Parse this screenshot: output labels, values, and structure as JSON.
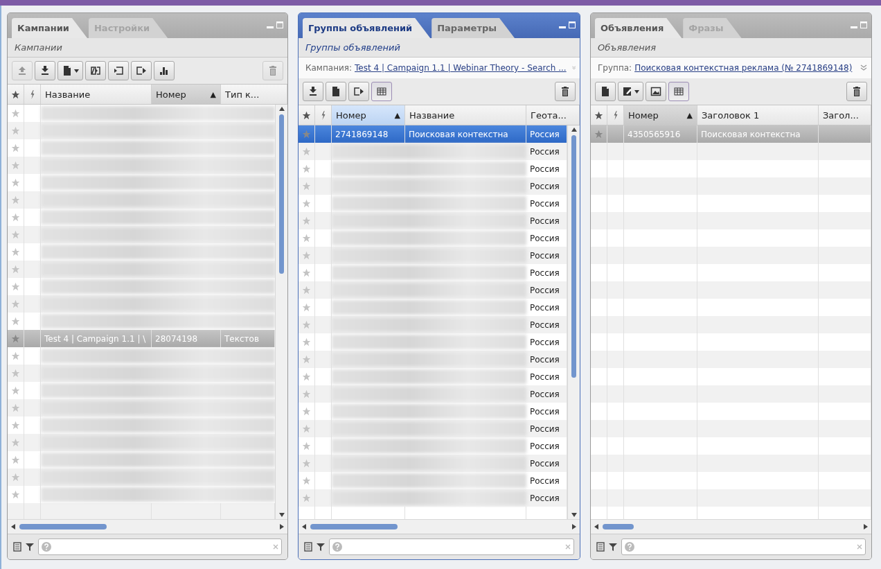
{
  "panels": [
    {
      "active": false,
      "tabs": [
        {
          "label": "Кампании",
          "selected": true
        },
        {
          "label": "Настройки",
          "selected": false
        }
      ],
      "subtitle": "Кампании",
      "toolbar": {
        "left": [
          {
            "kind": "upload",
            "disabled": true,
            "pressed": false
          },
          {
            "kind": "download",
            "disabled": false,
            "pressed": false
          },
          {
            "kind": "document-menu",
            "disabled": false,
            "pressed": false
          },
          {
            "kind": "split",
            "disabled": false,
            "pressed": false
          },
          {
            "kind": "box-in",
            "disabled": false,
            "pressed": false
          },
          {
            "kind": "box-out",
            "disabled": false,
            "pressed": false
          },
          {
            "kind": "chart",
            "disabled": false,
            "pressed": false
          }
        ],
        "right": [
          {
            "kind": "trash",
            "disabled": true,
            "pressed": false
          }
        ]
      },
      "table": {
        "columns": [
          {
            "label": "Название",
            "sorted": false
          },
          {
            "label": "Номер",
            "sorted": true,
            "sort_mark": "▲"
          },
          {
            "label": "Тип к...",
            "sorted": false
          }
        ],
        "rows": [
          {
            "selected": false,
            "blurred": true,
            "cells": []
          },
          {
            "selected": false,
            "blurred": true,
            "cells": []
          },
          {
            "selected": false,
            "blurred": true,
            "cells": []
          },
          {
            "selected": false,
            "blurred": true,
            "cells": []
          },
          {
            "selected": false,
            "blurred": true,
            "cells": []
          },
          {
            "selected": false,
            "blurred": true,
            "cells": []
          },
          {
            "selected": false,
            "blurred": true,
            "cells": []
          },
          {
            "selected": false,
            "blurred": true,
            "cells": []
          },
          {
            "selected": false,
            "blurred": true,
            "cells": []
          },
          {
            "selected": false,
            "blurred": true,
            "cells": []
          },
          {
            "selected": false,
            "blurred": true,
            "cells": []
          },
          {
            "selected": false,
            "blurred": true,
            "cells": []
          },
          {
            "selected": false,
            "blurred": true,
            "cells": []
          },
          {
            "selected": true,
            "blurred": false,
            "cells": [
              "Test 4 | Campaign 1.1 | \\",
              "28074198",
              "Текстов"
            ]
          },
          {
            "selected": false,
            "blurred": true,
            "cells": []
          },
          {
            "selected": false,
            "blurred": true,
            "cells": []
          },
          {
            "selected": false,
            "blurred": true,
            "cells": []
          },
          {
            "selected": false,
            "blurred": true,
            "cells": []
          },
          {
            "selected": false,
            "blurred": true,
            "cells": []
          },
          {
            "selected": false,
            "blurred": true,
            "cells": []
          },
          {
            "selected": false,
            "blurred": true,
            "cells": []
          },
          {
            "selected": false,
            "blurred": true,
            "cells": []
          },
          {
            "selected": false,
            "blurred": true,
            "cells": []
          }
        ]
      }
    },
    {
      "active": true,
      "tabs": [
        {
          "label": "Группы объявлений",
          "selected": true
        },
        {
          "label": "Параметры",
          "selected": false
        }
      ],
      "subtitle": "Группы объявлений",
      "context": {
        "label": "Кампания:",
        "link": "Test 4 | Campaign 1.1 | Webinar Theory - Search ..."
      },
      "toolbar": {
        "left": [
          {
            "kind": "download",
            "disabled": false,
            "pressed": false
          },
          {
            "kind": "document",
            "disabled": false,
            "pressed": false
          },
          {
            "kind": "box-out",
            "disabled": false,
            "pressed": false
          },
          {
            "kind": "grid",
            "disabled": false,
            "pressed": true
          }
        ],
        "right": [
          {
            "kind": "trash",
            "disabled": false,
            "pressed": false
          }
        ]
      },
      "table": {
        "columns": [
          {
            "label": "Номер",
            "sorted": true,
            "sort_mark": "▲"
          },
          {
            "label": "Название",
            "sorted": false
          },
          {
            "label": "Геота...",
            "sorted": false
          }
        ],
        "rows": [
          {
            "selected": true,
            "blurred": false,
            "cells": [
              "2741869148",
              "Поисковая контекстна",
              "Россия"
            ]
          },
          {
            "selected": false,
            "blurred": true,
            "cells": [
              "Россия"
            ]
          },
          {
            "selected": false,
            "blurred": true,
            "cells": [
              "Россия"
            ]
          },
          {
            "selected": false,
            "blurred": true,
            "cells": [
              "Россия"
            ]
          },
          {
            "selected": false,
            "blurred": true,
            "cells": [
              "Россия"
            ]
          },
          {
            "selected": false,
            "blurred": true,
            "cells": [
              "Россия"
            ]
          },
          {
            "selected": false,
            "blurred": true,
            "cells": [
              "Россия"
            ]
          },
          {
            "selected": false,
            "blurred": true,
            "cells": [
              "Россия"
            ]
          },
          {
            "selected": false,
            "blurred": true,
            "cells": [
              "Россия"
            ]
          },
          {
            "selected": false,
            "blurred": true,
            "cells": [
              "Россия"
            ]
          },
          {
            "selected": false,
            "blurred": true,
            "cells": [
              "Россия"
            ]
          },
          {
            "selected": false,
            "blurred": true,
            "cells": [
              "Россия"
            ]
          },
          {
            "selected": false,
            "blurred": true,
            "cells": [
              "Россия"
            ]
          },
          {
            "selected": false,
            "blurred": true,
            "cells": [
              "Россия"
            ]
          },
          {
            "selected": false,
            "blurred": true,
            "cells": [
              "Россия"
            ]
          },
          {
            "selected": false,
            "blurred": true,
            "cells": [
              "Россия"
            ]
          },
          {
            "selected": false,
            "blurred": true,
            "cells": [
              "Россия"
            ]
          },
          {
            "selected": false,
            "blurred": true,
            "cells": [
              "Россия"
            ]
          },
          {
            "selected": false,
            "blurred": true,
            "cells": [
              "Россия"
            ]
          },
          {
            "selected": false,
            "blurred": true,
            "cells": [
              "Россия"
            ]
          },
          {
            "selected": false,
            "blurred": true,
            "cells": [
              "Россия"
            ]
          },
          {
            "selected": false,
            "blurred": true,
            "cells": [
              "Россия"
            ]
          }
        ]
      }
    },
    {
      "active": false,
      "tabs": [
        {
          "label": "Объявления",
          "selected": true
        },
        {
          "label": "Фразы",
          "selected": false
        }
      ],
      "subtitle": "Объявления",
      "context": {
        "label": "Группа:",
        "link": "Поисковая контекстная реклама (№ 2741869148)"
      },
      "toolbar": {
        "left": [
          {
            "kind": "document",
            "disabled": false,
            "pressed": false
          },
          {
            "kind": "edit-menu",
            "disabled": false,
            "pressed": false
          },
          {
            "kind": "image",
            "disabled": false,
            "pressed": false
          },
          {
            "kind": "grid",
            "disabled": false,
            "pressed": true
          }
        ],
        "right": [
          {
            "kind": "trash",
            "disabled": false,
            "pressed": false
          }
        ]
      },
      "table": {
        "columns": [
          {
            "label": "Номер",
            "sorted": true,
            "sort_mark": "▲"
          },
          {
            "label": "Заголовок 1",
            "sorted": false
          },
          {
            "label": "Загол...",
            "sorted": false
          }
        ],
        "rows": [
          {
            "selected": true,
            "blurred": false,
            "cells": [
              "4350565916",
              "Поисковая контекстна"
            ]
          }
        ]
      }
    }
  ]
}
